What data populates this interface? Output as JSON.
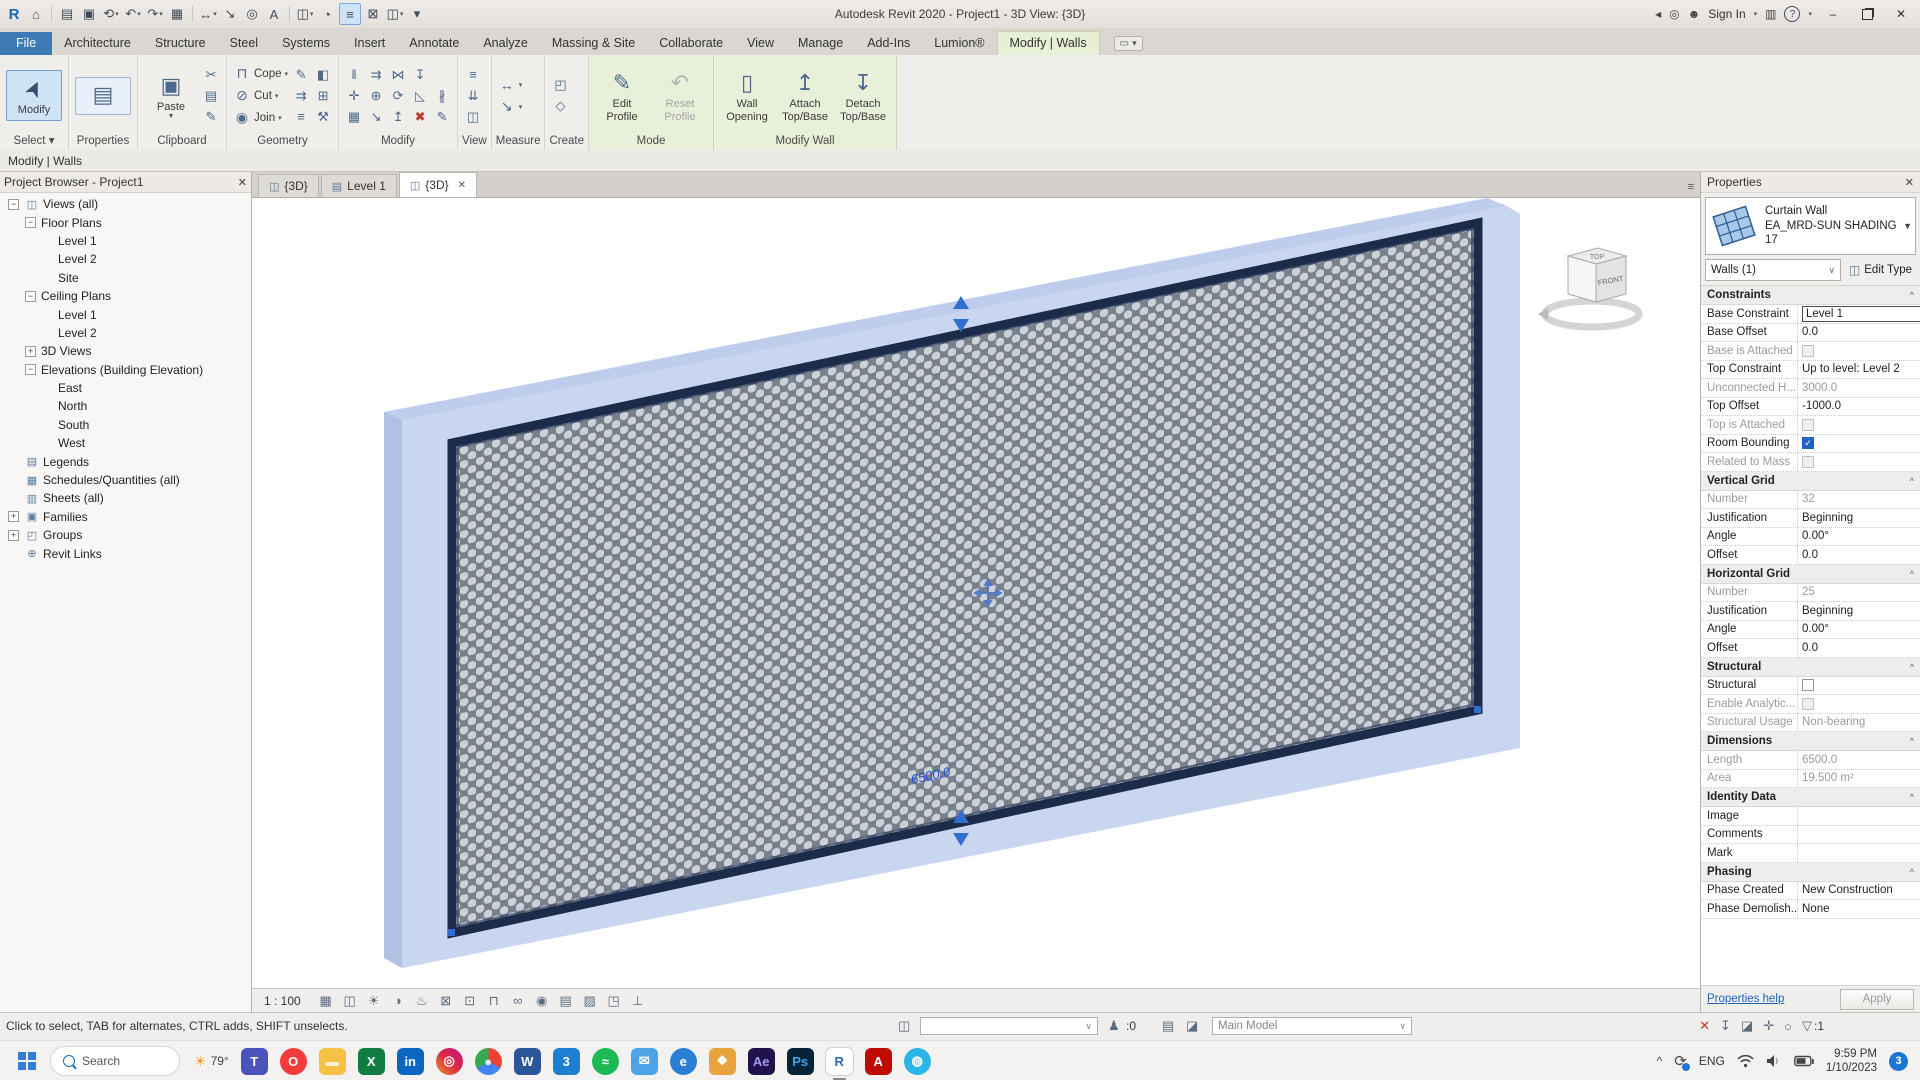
{
  "titlebar": {
    "title": "Autodesk Revit 2020 - Project1 - 3D View: {3D}",
    "qat": [
      {
        "name": "revit-logo",
        "glyph": "R",
        "revit": true
      },
      {
        "name": "home",
        "glyph": "⌂"
      },
      {
        "sep": true
      },
      {
        "name": "open",
        "glyph": "▤"
      },
      {
        "name": "save",
        "glyph": "▣"
      },
      {
        "name": "sync-with-central",
        "glyph": "⟲",
        "arrow": true
      },
      {
        "name": "undo",
        "glyph": "↶",
        "arrow": true
      },
      {
        "name": "redo",
        "glyph": "↷",
        "arrow": true
      },
      {
        "name": "print",
        "glyph": "▦"
      },
      {
        "sep": true
      },
      {
        "name": "measure",
        "glyph": "↔",
        "arrow": true
      },
      {
        "name": "aligned-dimension",
        "glyph": "↘"
      },
      {
        "name": "tag-by-category",
        "glyph": "◎"
      },
      {
        "name": "text",
        "glyph": "A"
      },
      {
        "sep": true
      },
      {
        "name": "default-3d-view",
        "glyph": "◫",
        "arrow": true
      },
      {
        "name": "section",
        "glyph": "◔"
      },
      {
        "name": "thin-lines",
        "glyph": "≡",
        "highlighted": true
      },
      {
        "name": "close-hidden-windows",
        "glyph": "⊠"
      },
      {
        "name": "switch-windows",
        "glyph": "◫",
        "arrow": true
      },
      {
        "name": "customize-qat",
        "glyph": "▾"
      }
    ],
    "signin_label": "Sign In",
    "window": {
      "minimize": "–",
      "close": "✕"
    }
  },
  "ribbon_tabs": {
    "items": [
      {
        "label": "File",
        "kind": "file"
      },
      {
        "label": "Architecture"
      },
      {
        "label": "Structure"
      },
      {
        "label": "Steel"
      },
      {
        "label": "Systems"
      },
      {
        "label": "Insert"
      },
      {
        "label": "Annotate"
      },
      {
        "label": "Analyze"
      },
      {
        "label": "Massing & Site"
      },
      {
        "label": "Collaborate"
      },
      {
        "label": "View"
      },
      {
        "label": "Manage"
      },
      {
        "label": "Add-Ins"
      },
      {
        "label": "Lumion®"
      },
      {
        "label": "Modify | Walls",
        "kind": "ctx"
      }
    ]
  },
  "ribbon": {
    "panels": [
      {
        "label": "Select ▾",
        "name": "select",
        "blocks": [
          {
            "type": "big",
            "items": [
              {
                "name": "modify-tool",
                "label": "Modify",
                "icon": "cursor",
                "highlighted": true
              }
            ]
          }
        ]
      },
      {
        "label": "Properties",
        "name": "properties",
        "blocks": [
          {
            "type": "big",
            "items": [
              {
                "name": "properties-palette",
                "label": "",
                "icon": "palette",
                "framed": true
              }
            ]
          }
        ]
      },
      {
        "label": "Clipboard",
        "name": "clipboard",
        "blocks": [
          {
            "type": "big",
            "items": [
              {
                "name": "paste",
                "label": "Paste",
                "icon": "clipboard",
                "arrow": true
              }
            ]
          },
          {
            "type": "grid",
            "rows": [
              [
                "cut-clipboard"
              ],
              [
                "copy-clipboard"
              ],
              [
                "match-type"
              ]
            ]
          }
        ]
      },
      {
        "label": "Geometry",
        "name": "geometry",
        "blocks": [
          {
            "type": "rows",
            "items": [
              {
                "name": "cope",
                "label": "Cope",
                "icon": "cope",
                "arrow": true
              },
              {
                "name": "cut-geometry",
                "label": "Cut",
                "icon": "cut",
                "arrow": true
              },
              {
                "name": "join-geometry",
                "label": "Join",
                "icon": "join",
                "arrow": true
              }
            ]
          },
          {
            "type": "grid",
            "rows": [
              [
                "paint",
                "solid-box"
              ],
              [
                "split-face",
                "profile-grid"
              ],
              [
                "wall-joins",
                "demolish-hammer"
              ]
            ]
          }
        ]
      },
      {
        "label": "Modify",
        "name": "modify",
        "blocks": [
          {
            "type": "grid",
            "rows": [
              [
                "align",
                "offset",
                "mirror-axis",
                "pin"
              ],
              [
                "move",
                "copy",
                "rotate",
                "trim",
                "split"
              ],
              [
                "array",
                "scale",
                "unpin",
                "delete",
                "match"
              ]
            ]
          }
        ]
      },
      {
        "label": "View",
        "name": "view",
        "blocks": [
          {
            "type": "grid",
            "rows": [
              [
                "thin-lines-view"
              ],
              [
                "hidden-elements"
              ],
              [
                "viewer"
              ]
            ]
          }
        ]
      },
      {
        "label": "Measure",
        "name": "measure",
        "blocks": [
          {
            "type": "rows",
            "items": [
              {
                "name": "measure-between",
                "label": "",
                "icon": "measure-line",
                "arrow": true
              },
              {
                "name": "dimension",
                "label": "",
                "icon": "dimension",
                "arrow": true
              }
            ]
          }
        ]
      },
      {
        "label": "Create",
        "name": "create",
        "blocks": [
          {
            "type": "grid",
            "rows": [
              [
                "create-group"
              ],
              [
                "create-parts"
              ]
            ]
          }
        ]
      },
      {
        "label": "Mode",
        "name": "mode",
        "green": true,
        "blocks": [
          {
            "type": "big",
            "items": [
              {
                "name": "edit-profile",
                "label": "Edit Profile",
                "icon": "edit-profile"
              },
              {
                "name": "reset-profile",
                "label": "Reset Profile",
                "icon": "reset-profile",
                "disabled": true
              }
            ]
          }
        ]
      },
      {
        "label": "Modify Wall",
        "name": "modify-wall",
        "green": true,
        "blocks": [
          {
            "type": "big",
            "items": [
              {
                "name": "wall-opening",
                "label": "Wall Opening",
                "icon": "wall-opening"
              },
              {
                "name": "attach-top-base",
                "label": "Attach Top/Base",
                "icon": "attach"
              },
              {
                "name": "detach-top-base",
                "label": "Detach Top/Base",
                "icon": "detach"
              }
            ]
          }
        ]
      }
    ]
  },
  "mode_bar": {
    "label": "Modify | Walls"
  },
  "project_browser": {
    "title": "Project Browser - Project1",
    "tree": [
      {
        "label": "Views (all)",
        "depth": 0,
        "toggle": "minus",
        "icon": "views"
      },
      {
        "label": "Floor Plans",
        "depth": 1,
        "toggle": "minus"
      },
      {
        "label": "Level 1",
        "depth": 2
      },
      {
        "label": "Level 2",
        "depth": 2
      },
      {
        "label": "Site",
        "depth": 2
      },
      {
        "label": "Ceiling Plans",
        "depth": 1,
        "toggle": "minus"
      },
      {
        "label": "Level 1",
        "depth": 2
      },
      {
        "label": "Level 2",
        "depth": 2
      },
      {
        "label": "3D Views",
        "depth": 1,
        "toggle": "plus"
      },
      {
        "label": "Elevations (Building Elevation)",
        "depth": 1,
        "toggle": "minus"
      },
      {
        "label": "East",
        "depth": 2
      },
      {
        "label": "North",
        "depth": 2
      },
      {
        "label": "South",
        "depth": 2
      },
      {
        "label": "West",
        "depth": 2
      },
      {
        "label": "Legends",
        "depth": 0,
        "icon": "legends"
      },
      {
        "label": "Schedules/Quantities (all)",
        "depth": 0,
        "icon": "schedules"
      },
      {
        "label": "Sheets (all)",
        "depth": 0,
        "icon": "sheets"
      },
      {
        "label": "Families",
        "depth": 0,
        "toggle": "plus",
        "icon": "families"
      },
      {
        "label": "Groups",
        "depth": 0,
        "toggle": "plus",
        "icon": "groups"
      },
      {
        "label": "Revit Links",
        "depth": 0,
        "icon": "links"
      }
    ]
  },
  "view_tabs": {
    "tabs": [
      {
        "label": "{3D}",
        "icon": "3d-view"
      },
      {
        "label": "Level 1",
        "icon": "floor-plan"
      },
      {
        "label": "{3D}",
        "icon": "3d-view",
        "active": true,
        "close": "✕"
      }
    ]
  },
  "canvas": {
    "dimension_text": "6500.0",
    "viewcube_front": "FRONT",
    "viewcube_top": "TOP"
  },
  "view_control_bar": {
    "scale": "1 : 100",
    "icons": [
      "detail-level",
      "visual-style",
      "sun-path",
      "shadows",
      "render",
      "crop-view",
      "show-crop-region",
      "lock-3d-view",
      "temporary-hide-isolate",
      "reveal-hidden-elements",
      "temporary-view-properties",
      "show-analytical-model",
      "highlight-displacement",
      "reveal-constraints"
    ]
  },
  "properties": {
    "header": "Properties",
    "type_selector": {
      "category": "Curtain Wall",
      "family": "EA_MRD-SUN SHADING",
      "type_number": "17"
    },
    "selection_label": "Walls (1)",
    "edit_type_label": "Edit Type",
    "sections": [
      {
        "title": "Constraints",
        "rows": [
          {
            "label": "Base Constraint",
            "value": "Level 1",
            "kind": "input",
            "focused": true
          },
          {
            "label": "Base Offset",
            "value": "0.0"
          },
          {
            "label": "Base is Attached",
            "kind": "checkbox",
            "disabled": true
          },
          {
            "label": "Top Constraint",
            "value": "Up to level: Level 2"
          },
          {
            "label": "Unconnected H...",
            "value": "3000.0",
            "disabled": true
          },
          {
            "label": "Top Offset",
            "value": "-1000.0"
          },
          {
            "label": "Top is Attached",
            "kind": "checkbox",
            "disabled": true
          },
          {
            "label": "Room Bounding",
            "kind": "checkbox",
            "checked": true
          },
          {
            "label": "Related to Mass",
            "kind": "checkbox",
            "disabled": true
          }
        ]
      },
      {
        "title": "Vertical Grid",
        "rows": [
          {
            "label": "Number",
            "value": "32",
            "disabled": true
          },
          {
            "label": "Justification",
            "value": "Beginning"
          },
          {
            "label": "Angle",
            "value": "0.00°"
          },
          {
            "label": "Offset",
            "value": "0.0"
          }
        ]
      },
      {
        "title": "Horizontal Grid",
        "rows": [
          {
            "label": "Number",
            "value": "25",
            "disabled": true
          },
          {
            "label": "Justification",
            "value": "Beginning"
          },
          {
            "label": "Angle",
            "value": "0.00°"
          },
          {
            "label": "Offset",
            "value": "0.0"
          }
        ]
      },
      {
        "title": "Structural",
        "rows": [
          {
            "label": "Structural",
            "kind": "checkbox"
          },
          {
            "label": "Enable Analytic...",
            "kind": "checkbox",
            "disabled": true
          },
          {
            "label": "Structural Usage",
            "value": "Non-bearing",
            "disabled": true
          }
        ]
      },
      {
        "title": "Dimensions",
        "rows": [
          {
            "label": "Length",
            "value": "6500.0",
            "disabled": true
          },
          {
            "label": "Area",
            "value": "19.500 m²",
            "disabled": true
          }
        ]
      },
      {
        "title": "Identity Data",
        "rows": [
          {
            "label": "Image",
            "value": ""
          },
          {
            "label": "Comments",
            "value": ""
          },
          {
            "label": "Mark",
            "value": ""
          }
        ]
      },
      {
        "title": "Phasing",
        "rows": [
          {
            "label": "Phase Created",
            "value": "New Construction"
          },
          {
            "label": "Phase Demolish...",
            "value": "None"
          }
        ]
      }
    ],
    "footer": {
      "help": "Properties help",
      "apply": "Apply"
    }
  },
  "status_bar": {
    "hint": "Click to select, TAB for alternates, CTRL adds, SHIFT unselects.",
    "editing_requests": ":0",
    "design_option": "Main Model",
    "right_icons": [
      "select-links-toggle",
      "select-pinned-toggle",
      "select-underlay-toggle",
      "drag-on-selection-toggle",
      "background-processes",
      "filter"
    ],
    "filter_count": ":1"
  },
  "taskbar": {
    "search_placeholder": "Search",
    "weather": "79°",
    "apps": [
      {
        "name": "teams",
        "glyph": "T",
        "bg": "#4a53bb",
        "fg": "#ffffff"
      },
      {
        "name": "opera",
        "glyph": "O",
        "bg": "#f53b3b",
        "fg": "#ffffff",
        "round": true
      },
      {
        "name": "file-explorer",
        "glyph": "▬",
        "bg": "#f6c243",
        "fg": "#fff4d6"
      },
      {
        "name": "excel",
        "glyph": "X",
        "bg": "#107c41",
        "fg": "#ffffff"
      },
      {
        "name": "linkedin",
        "glyph": "in",
        "bg": "#0a66c2",
        "fg": "#ffffff"
      },
      {
        "name": "instagram",
        "glyph": "◎",
        "bg": "linear-gradient(45deg,#f09433,#dc2743,#bc1888)",
        "fg": "#ffffff",
        "round": true
      },
      {
        "name": "chrome",
        "glyph": "●",
        "bg": "conic-gradient(#ea4335 0 33%,#4285f4 33% 66%,#34a853 66% 100%)",
        "fg": "#dbe8fb",
        "round": true
      },
      {
        "name": "word",
        "glyph": "W",
        "bg": "#2b579a",
        "fg": "#ffffff"
      },
      {
        "name": "3ds-max",
        "glyph": "3",
        "bg": "#1e7fd0",
        "fg": "#ffffff"
      },
      {
        "name": "spotify",
        "glyph": "≈",
        "bg": "#1db954",
        "fg": "#ffffff",
        "round": true
      },
      {
        "name": "mail",
        "glyph": "✉",
        "bg": "#4da3e8",
        "fg": "#ffffff"
      },
      {
        "name": "edge",
        "glyph": "e",
        "bg": "#2a7fd4",
        "fg": "#ffffff",
        "round": true
      },
      {
        "name": "photos",
        "glyph": "❖",
        "bg": "#e8a33d",
        "fg": "#ffffff"
      },
      {
        "name": "after-effects",
        "glyph": "Ae",
        "bg": "#20124d",
        "fg": "#a49bf0"
      },
      {
        "name": "photoshop",
        "glyph": "Ps",
        "bg": "#062438",
        "fg": "#35a7f0"
      },
      {
        "name": "revit",
        "glyph": "R",
        "bg": "#ffffff",
        "fg": "#2a6db5",
        "active": true
      },
      {
        "name": "acrobat",
        "glyph": "A",
        "bg": "#c00b00",
        "fg": "#ffffff"
      },
      {
        "name": "messenger",
        "glyph": "◍",
        "bg": "#2ab4e8",
        "fg": "#ffffff",
        "round": true
      }
    ],
    "tray": {
      "language": "ENG",
      "time": "9:59 PM",
      "date": "1/10/2023",
      "badge": "3"
    }
  }
}
